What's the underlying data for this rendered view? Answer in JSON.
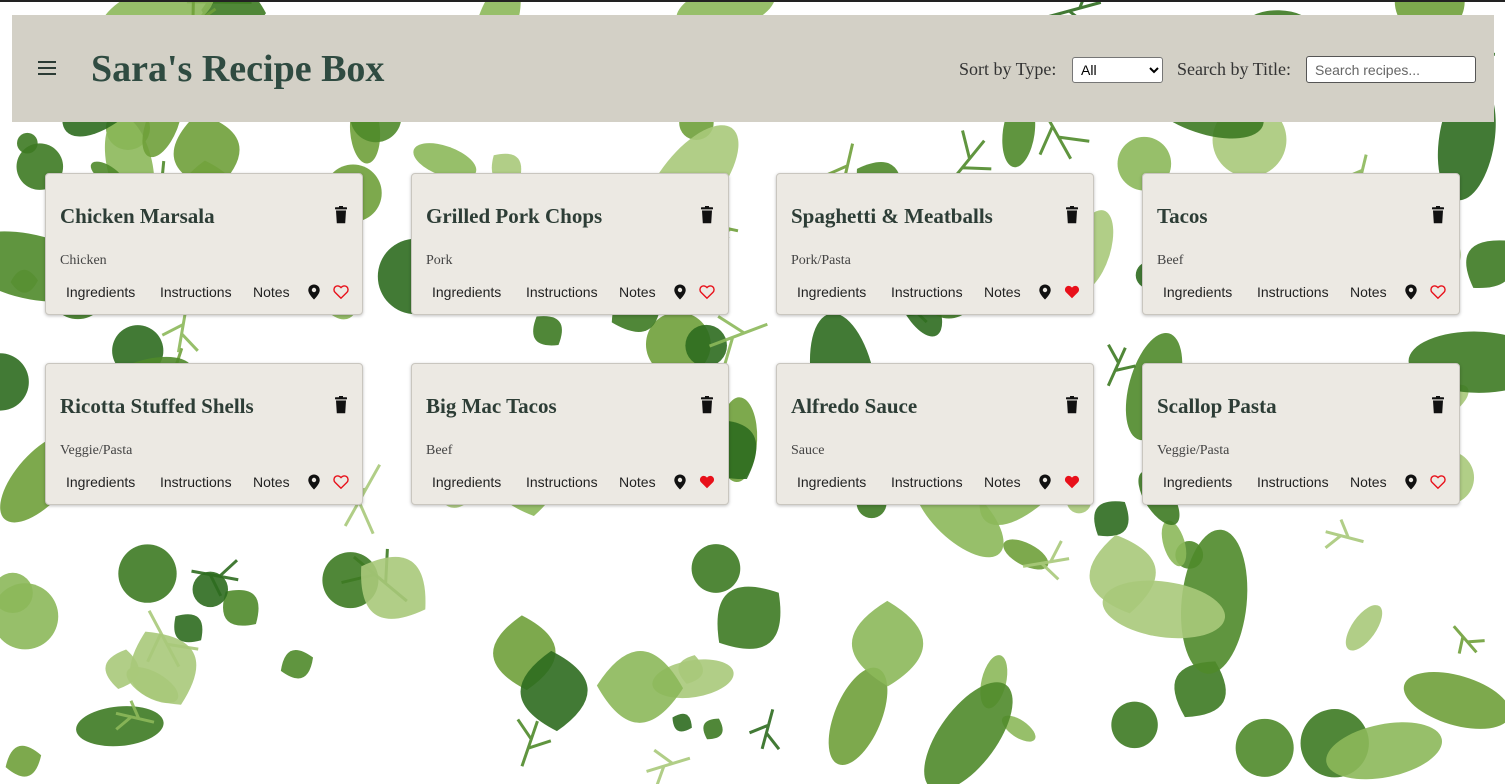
{
  "header": {
    "title": "Sara's Recipe Box",
    "sort_label": "Sort by Type:",
    "sort_selected": "All",
    "search_label": "Search by Title:",
    "search_placeholder": "Search recipes...",
    "search_value": ""
  },
  "card_links": {
    "ingredients": "Ingredients",
    "instructions": "Instructions",
    "notes": "Notes"
  },
  "recipes": [
    {
      "title": "Chicken Marsala",
      "type": "Chicken",
      "favorite": false
    },
    {
      "title": "Grilled Pork Chops",
      "type": "Pork",
      "favorite": false
    },
    {
      "title": "Spaghetti & Meatballs",
      "type": "Pork/Pasta",
      "favorite": true
    },
    {
      "title": "Tacos",
      "type": "Beef",
      "favorite": false
    },
    {
      "title": "Ricotta Stuffed Shells",
      "type": "Veggie/Pasta",
      "favorite": false
    },
    {
      "title": "Big Mac Tacos",
      "type": "Beef",
      "favorite": true
    },
    {
      "title": "Alfredo Sauce",
      "type": "Sauce",
      "favorite": true
    },
    {
      "title": "Scallop Pasta",
      "type": "Veggie/Pasta",
      "favorite": false
    }
  ],
  "colors": {
    "header_bg": "#d3d0c6",
    "title": "#2f4b41",
    "card_bg": "#ece9e3",
    "favorite_red": "#e8101a",
    "leaf_dark": "#2e6b1f",
    "leaf_mid": "#6fa03a",
    "leaf_light": "#a9c97a"
  },
  "icons": [
    "menu-icon",
    "trash-icon",
    "map-pin-icon",
    "heart-icon"
  ]
}
